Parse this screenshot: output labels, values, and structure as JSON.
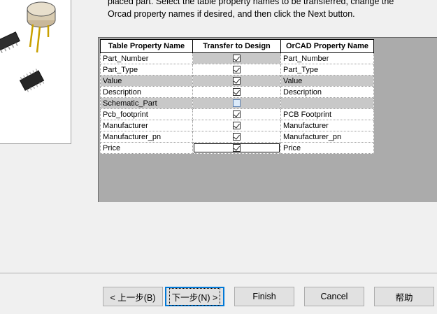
{
  "instruction": {
    "line1": "placed part. Select the table property names to be transferred, change the",
    "line2": "Orcad property names if desired, and then click the Next button."
  },
  "grid": {
    "headers": [
      "Table Property Name",
      "Transfer to Design",
      "OrCAD Property Name"
    ],
    "rows": [
      {
        "table_name": "Part_Number",
        "transfer": true,
        "orcad_name": "Part_Number"
      },
      {
        "table_name": "Part_Type",
        "transfer": true,
        "orcad_name": "Part_Type"
      },
      {
        "table_name": "Value",
        "transfer": true,
        "orcad_name": "Value"
      },
      {
        "table_name": "Description",
        "transfer": true,
        "orcad_name": "Description"
      },
      {
        "table_name": "Schematic_Part",
        "transfer": false,
        "orcad_name": ""
      },
      {
        "table_name": "Pcb_footprint",
        "transfer": true,
        "orcad_name": "PCB Footprint"
      },
      {
        "table_name": "Manufacturer",
        "transfer": true,
        "orcad_name": "Manufacturer"
      },
      {
        "table_name": "Manufacturer_pn",
        "transfer": true,
        "orcad_name": "Manufacturer_pn"
      },
      {
        "table_name": "Price",
        "transfer": true,
        "orcad_name": "Price"
      }
    ]
  },
  "buttons": {
    "back": "< 上一步(B)",
    "next": "下一步(N) >",
    "finish": "Finish",
    "cancel": "Cancel",
    "help": "帮助"
  },
  "colors": {
    "selected_row": "#c8c8c8",
    "default_button_border": "#0078d7",
    "background": "#f0f0f0"
  },
  "icons": [
    "to-package-icon",
    "soic-chip-icon",
    "tssop-chip-icon"
  ]
}
